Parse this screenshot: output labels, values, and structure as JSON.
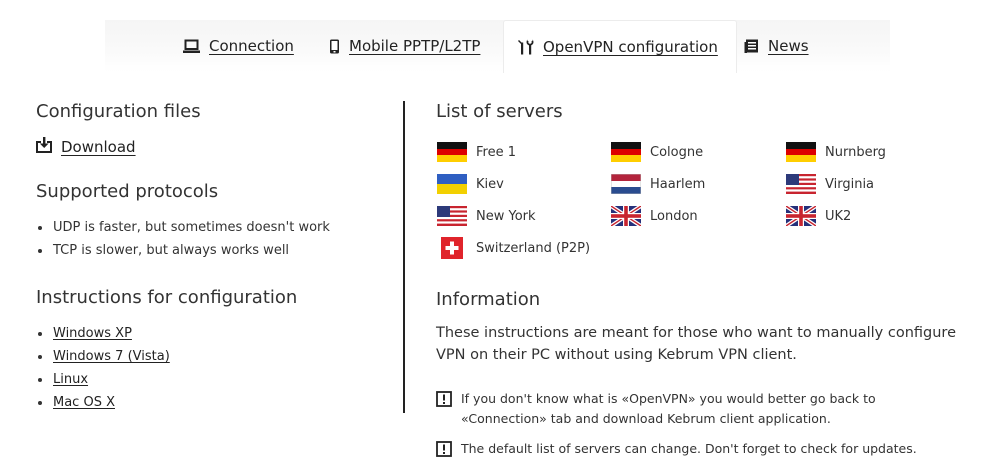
{
  "tabs": [
    {
      "id": "connection",
      "label": "Connection",
      "icon": "laptop-icon"
    },
    {
      "id": "mobile",
      "label": "Mobile PPTP/L2TP",
      "icon": "phone-icon"
    },
    {
      "id": "openvpn",
      "label": "OpenVPN configuration",
      "icon": "tools-icon",
      "active": true
    },
    {
      "id": "news",
      "label": "News",
      "icon": "newspaper-icon"
    }
  ],
  "left": {
    "config_title": "Configuration files",
    "download_label": "Download",
    "protocols_title": "Supported protocols",
    "protocols": [
      "UDP is faster, but sometimes doesn't work",
      "TCP is slower, but always works well"
    ],
    "instructions_title": "Instructions for configuration",
    "instructions": [
      "Windows XP",
      "Windows 7 (Vista)",
      "Linux",
      "Mac OS X"
    ]
  },
  "right": {
    "servers_title": "List of servers",
    "servers": [
      {
        "name": "Free 1",
        "flag": "de"
      },
      {
        "name": "Cologne",
        "flag": "de"
      },
      {
        "name": "Nurnberg",
        "flag": "de"
      },
      {
        "name": "Kiev",
        "flag": "ua"
      },
      {
        "name": "Haarlem",
        "flag": "nl"
      },
      {
        "name": "Virginia",
        "flag": "us"
      },
      {
        "name": "New York",
        "flag": "us"
      },
      {
        "name": "London",
        "flag": "gb"
      },
      {
        "name": "UK2",
        "flag": "gb"
      },
      {
        "name": "Switzerland (P2P)",
        "flag": "ch"
      }
    ],
    "info_title": "Information",
    "info_text": "These instructions are meant for those who want to manually configure VPN on their PC without using Kebrum VPN client.",
    "notes": [
      "If you don't know what is «OpenVPN» you would better go back to «Connection» tab and download Kebrum client application.",
      "The default list of servers can change. Don't forget to check for updates."
    ]
  }
}
